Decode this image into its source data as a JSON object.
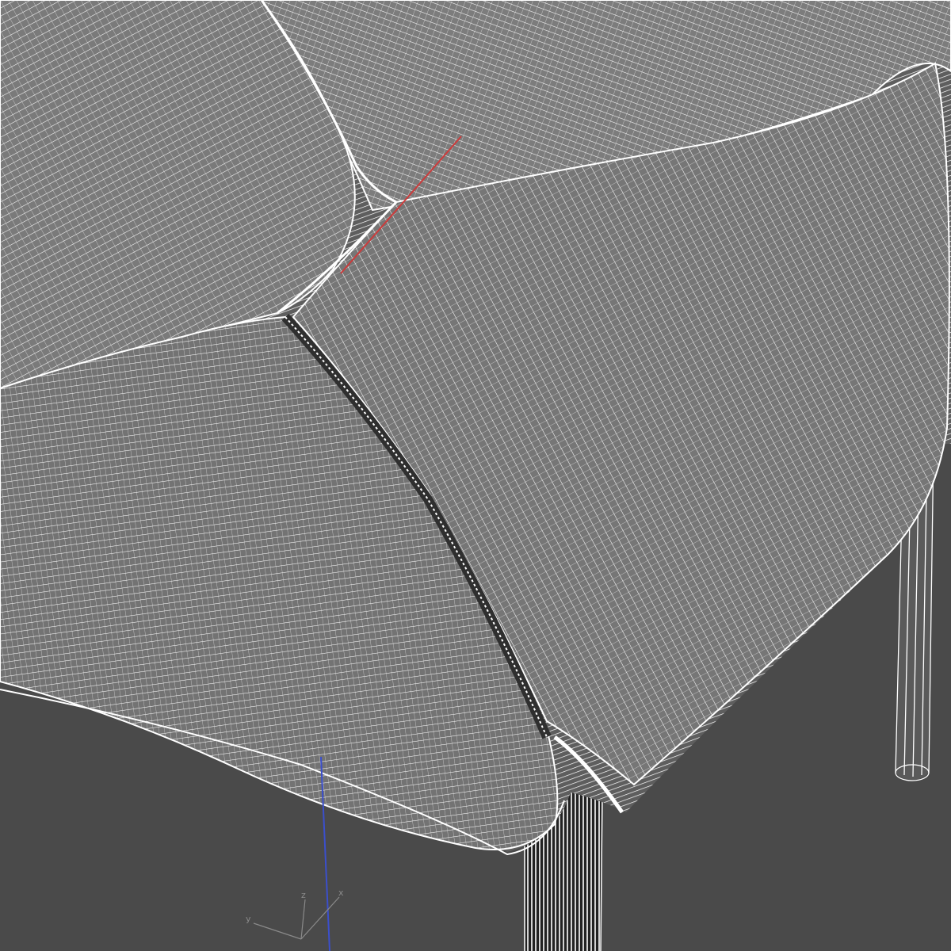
{
  "viewport": {
    "background_color": "#4a4a4a",
    "wireframe_color": "#ffffff",
    "mesh_fill_color": "#777777",
    "axis_colors": {
      "x": "#cc3b3b",
      "y": "#3ccc3b",
      "z": "#3b4fcc"
    }
  },
  "gizmo": {
    "x_label": "x",
    "y_label": "y",
    "z_label": "z"
  }
}
